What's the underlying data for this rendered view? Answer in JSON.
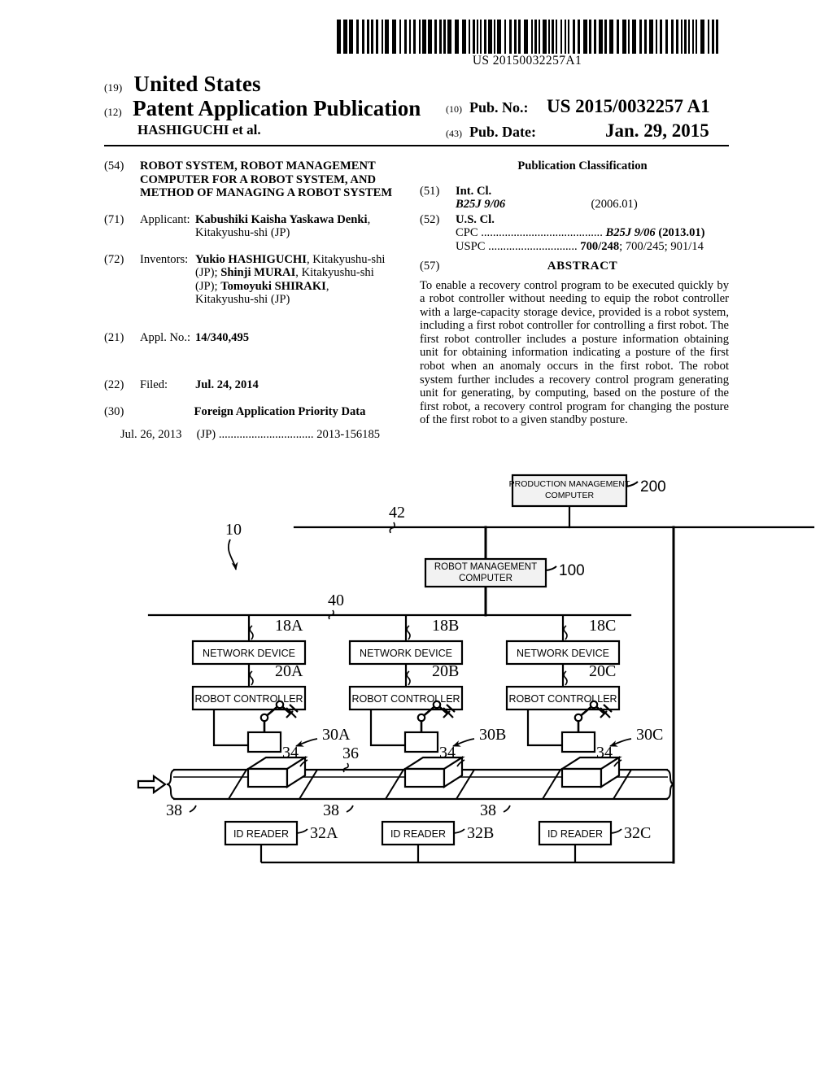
{
  "header": {
    "barcode_number": "US 20150032257A1",
    "country_code": "(19)",
    "country": "United States",
    "doc_type_code": "(12)",
    "doc_type": "Patent Application Publication",
    "authors": "HASHIGUCHI et al.",
    "pubno_code": "(10)",
    "pubno_label": "Pub. No.:",
    "pubno_value": "US 2015/0032257 A1",
    "pubdate_code": "(43)",
    "pubdate_label": "Pub. Date:",
    "pubdate_value": "Jan. 29, 2015"
  },
  "left_column": {
    "title_code": "(54)",
    "title_lines": [
      "ROBOT SYSTEM, ROBOT MANAGEMENT",
      "COMPUTER FOR A ROBOT SYSTEM, AND",
      "METHOD OF MANAGING A ROBOT SYSTEM"
    ],
    "applicant_code": "(71)",
    "applicant_label": "Applicant:",
    "applicant_name": "Kabushiki Kaisha Yaskawa Denki",
    "applicant_comma": ",",
    "applicant_city": "Kitakyushu-shi (JP)",
    "inventors_code": "(72)",
    "inventors_label": "Inventors:",
    "inventors_line1_b": "Yukio HASHIGUCHI",
    "inventors_line1_r": ", Kitakyushu-shi",
    "inventors_line2_p": "(JP); ",
    "inventors_line2_b": "Shinji MURAI",
    "inventors_line2_r": ", Kitakyushu-shi",
    "inventors_line3_p": "(JP); ",
    "inventors_line3_b": "Tomoyuki SHIRAKI",
    "inventors_line3_r": ",",
    "inventors_line4": "Kitakyushu-shi (JP)",
    "applno_code": "(21)",
    "applno_label": "Appl. No.:",
    "applno_value": "14/340,495",
    "filed_code": "(22)",
    "filed_label": "Filed:",
    "filed_value": "Jul. 24, 2014",
    "fpd_code": "(30)",
    "fpd_heading": "Foreign Application Priority Data",
    "fpd_date": "Jul. 26, 2013",
    "fpd_country": "(JP)",
    "fpd_dots": "................................",
    "fpd_number": "2013-156185"
  },
  "right_column": {
    "pubclass_heading": "Publication Classification",
    "intcl_code": "(51)",
    "intcl_label": "Int. Cl.",
    "intcl_class": "B25J 9/06",
    "intcl_version": "(2006.01)",
    "uscl_code": "(52)",
    "uscl_label": "U.S. Cl.",
    "cpc_label": "CPC",
    "cpc_dots": ".........................................",
    "cpc_class": "B25J 9/06",
    "cpc_version": "(2013.01)",
    "uspc_label": "USPC",
    "uspc_dots": "..............................",
    "uspc_primary": "700/248",
    "uspc_rest": "; 700/245; 901/14",
    "abstract_code": "(57)",
    "abstract_heading": "ABSTRACT",
    "abstract_text": "To enable a recovery control program to be executed quickly by a robot controller without needing to equip the robot controller with a large-capacity storage device, provided is a robot system, including a first robot controller for controlling a first robot. The first robot controller includes a posture information obtaining unit for obtaining information indicating a posture of the first robot when an anomaly occurs in the first robot. The robot system further includes a recovery control program generating unit for generating, by computing, based on the posture of the first robot, a recovery control program for changing the posture of the first robot to a given standby posture."
  },
  "figure": {
    "system_ref": "10",
    "top_bus_ref": "42",
    "mid_bus_ref": "40",
    "production_computer": {
      "line1": "PRODUCTION MANAGEMENT",
      "line2": "COMPUTER",
      "ref": "200"
    },
    "robot_management_computer": {
      "line1": "ROBOT MANAGEMENT",
      "line2": "COMPUTER",
      "ref": "100"
    },
    "network_devices": [
      {
        "label": "NETWORK DEVICE",
        "ref": "18A"
      },
      {
        "label": "NETWORK DEVICE",
        "ref": "18B"
      },
      {
        "label": "NETWORK DEVICE",
        "ref": "18C"
      }
    ],
    "robot_controllers": [
      {
        "label": "ROBOT CONTROLLER",
        "ref": "20A"
      },
      {
        "label": "ROBOT CONTROLLER",
        "ref": "20B"
      },
      {
        "label": "ROBOT CONTROLLER",
        "ref": "20C"
      }
    ],
    "robots": [
      {
        "ref": "30A"
      },
      {
        "ref": "30B"
      },
      {
        "ref": "30C"
      }
    ],
    "workpieces": [
      {
        "ref": "34"
      },
      {
        "ref": "34"
      },
      {
        "ref": "34"
      }
    ],
    "pallets": [
      {
        "ref": "38"
      },
      {
        "ref": "38"
      },
      {
        "ref": "38"
      }
    ],
    "conveyor_ref": "36",
    "id_readers": [
      {
        "label": "ID READER",
        "ref": "32A"
      },
      {
        "label": "ID READER",
        "ref": "32B"
      },
      {
        "label": "ID READER",
        "ref": "32C"
      }
    ]
  },
  "colors": {
    "ink": "#000000",
    "paper": "#ffffff",
    "box_fill": "#f2f2f2"
  }
}
